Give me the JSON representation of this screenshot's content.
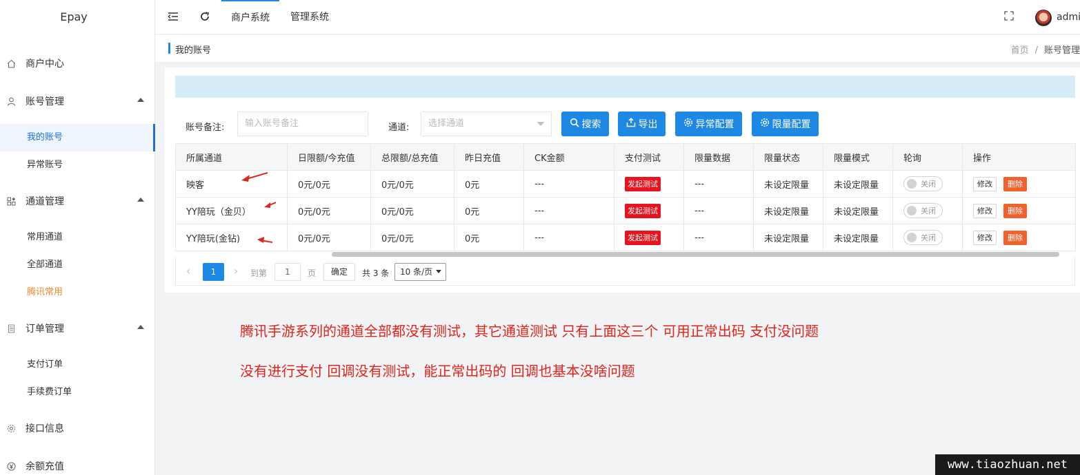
{
  "app": {
    "brand": "Epay"
  },
  "sidebar": {
    "groups": [
      {
        "label": "商户中心",
        "icon": "home-icon"
      },
      {
        "label": "账号管理",
        "icon": "user-icon"
      },
      {
        "label": "通道管理",
        "icon": "apps-icon"
      },
      {
        "label": "订单管理",
        "icon": "document-icon"
      },
      {
        "label": "接口信息",
        "icon": "gear-icon"
      },
      {
        "label": "余额充值",
        "icon": "yen-icon"
      }
    ],
    "subs": [
      {
        "label": "我的账号"
      },
      {
        "label": "异常账号"
      },
      {
        "label": "常用通道"
      },
      {
        "label": "全部通道"
      },
      {
        "label": "腾讯常用"
      },
      {
        "label": "支付订单"
      },
      {
        "label": "手续费订单"
      }
    ]
  },
  "header": {
    "tabs": [
      {
        "label": "商户系统"
      },
      {
        "label": "管理系统"
      }
    ],
    "user": "admin"
  },
  "page": {
    "title": "我的账号",
    "breadcrumb": [
      "首页",
      "/",
      "账号管理"
    ]
  },
  "filters": {
    "remark_label": "账号备注:",
    "remark_placeholder": "输入账号备注",
    "channel_label": "通道:",
    "channel_placeholder": "选择通道",
    "buttons": [
      "搜索",
      "导出",
      "异常配置",
      "限量配置"
    ]
  },
  "table": {
    "headers": [
      "所属通道",
      "日限额/今充值",
      "总限额/总充值",
      "昨日充值",
      "CK金额",
      "支付测试",
      "限量数据",
      "限量状态",
      "限量模式",
      "轮询",
      "操作"
    ],
    "rows": [
      {
        "channel": "映客",
        "daily": "0元/0元",
        "total": "0元/0元",
        "yesterday": "0元",
        "ck": "---",
        "test": "发起测试",
        "limit_data": "---",
        "limit_status": "未设定限量",
        "limit_mode": "未设定限量",
        "poll": "关闭",
        "edit": "修改",
        "delete": "删除"
      },
      {
        "channel": "YY陪玩（金贝）",
        "daily": "0元/0元",
        "total": "0元/0元",
        "yesterday": "0元",
        "ck": "---",
        "test": "发起测试",
        "limit_data": "---",
        "limit_status": "未设定限量",
        "limit_mode": "未设定限量",
        "poll": "关闭",
        "edit": "修改",
        "delete": "删除"
      },
      {
        "channel": "YY陪玩(金钻)",
        "daily": "0元/0元",
        "total": "0元/0元",
        "yesterday": "0元",
        "ck": "---",
        "test": "发起测试",
        "limit_data": "---",
        "limit_status": "未设定限量",
        "limit_mode": "未设定限量",
        "poll": "关闭",
        "edit": "修改",
        "delete": "删除"
      }
    ]
  },
  "pagination": {
    "current": "1",
    "goto_label": "到第",
    "goto_value": "1",
    "page_unit": "页",
    "confirm": "确定",
    "total": "共 3 条",
    "page_size": "10 条/页"
  },
  "annotations": [
    "腾讯手游系列的通道全部都没有测试，其它通道测试 只有上面这三个 可用正常出码 支付没问题",
    "没有进行支付 回调没有测试，能正常出码的 回调也基本没啥问题"
  ],
  "watermark": "www.tiaozhuan.net",
  "colors": {
    "primary": "#1e88e5",
    "danger": "#e8131f",
    "warn": "#f0612e",
    "annotation": "#e0231b",
    "highlight": "#f0892b"
  }
}
